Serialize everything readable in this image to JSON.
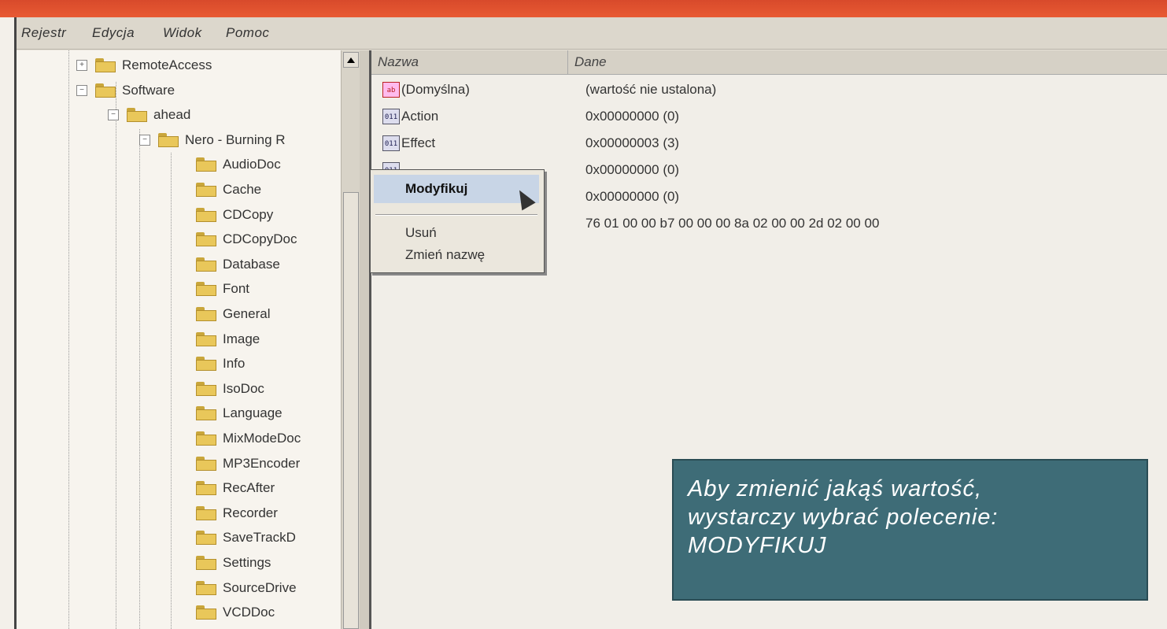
{
  "menu": {
    "items": [
      "Rejestr",
      "Edycja",
      "Widok",
      "Pomoc"
    ]
  },
  "tree": {
    "items": [
      {
        "label": "RemoteAccess",
        "expander": "+",
        "folder": true
      },
      {
        "label": "Software",
        "expander": "−",
        "folder": true
      },
      {
        "label": "ahead",
        "expander": "−",
        "folder": true
      },
      {
        "label": "Nero - Burning R",
        "expander": "−",
        "folder": true
      },
      {
        "label": "AudioDoc",
        "folder": true
      },
      {
        "label": "Cache",
        "folder": true
      },
      {
        "label": "CDCopy",
        "folder": true
      },
      {
        "label": "CDCopyDoc",
        "folder": true
      },
      {
        "label": "Database",
        "folder": true
      },
      {
        "label": "Font",
        "folder": true
      },
      {
        "label": "General",
        "folder": true
      },
      {
        "label": "Image",
        "folder": true
      },
      {
        "label": "Info",
        "folder": true
      },
      {
        "label": "IsoDoc",
        "folder": true
      },
      {
        "label": "Language",
        "folder": true
      },
      {
        "label": "MixModeDoc",
        "folder": true
      },
      {
        "label": "MP3Encoder",
        "folder": true
      },
      {
        "label": "RecAfter",
        "folder": true
      },
      {
        "label": "Recorder",
        "folder": true
      },
      {
        "label": "SaveTrackD",
        "folder": true
      },
      {
        "label": "Settings",
        "folder": true
      },
      {
        "label": "SourceDrive",
        "folder": true
      },
      {
        "label": "VCDDoc",
        "folder": true
      }
    ]
  },
  "list": {
    "headers": {
      "name": "Nazwa",
      "data": "Dane"
    },
    "rows": [
      {
        "name": "(Domyślna)",
        "data": "(wartość nie ustalona)",
        "icon": "string-value-icon"
      },
      {
        "name": "Action",
        "data": "0x00000000 (0)",
        "icon": "binary-value-icon"
      },
      {
        "name": "Effect",
        "data": "0x00000003 (3)",
        "icon": "binary-value-icon"
      },
      {
        "name": "",
        "data": "0x00000000 (0)",
        "icon": "binary-value-icon"
      },
      {
        "name": "",
        "data": "0x00000000 (0)",
        "icon": "binary-value-icon"
      },
      {
        "name": "",
        "data": "76 01 00 00 b7 00 00 00 8a 02 00 00 2d 02 00 00",
        "icon": "binary-value-icon"
      }
    ]
  },
  "context_menu": {
    "items": [
      "Modyfikuj",
      "Usuń",
      "Zmień nazwę"
    ],
    "active": "Modyfikuj"
  },
  "callout": {
    "lines": [
      "Aby zmienić jakąś wartość,",
      "wystarczy wybrać polecenie:",
      "MODYFIKUJ"
    ]
  },
  "colors": {
    "callout_bg": "#3e6c77",
    "top_bar": "#e0502f",
    "menu_highlight": "#c8d5e6"
  }
}
